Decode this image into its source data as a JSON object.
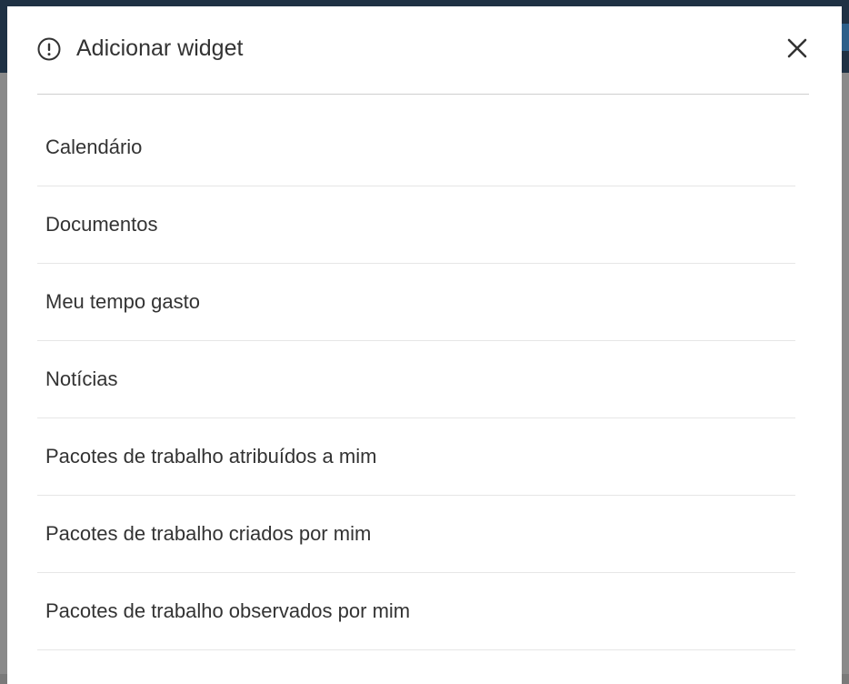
{
  "modal": {
    "title": "Adicionar widget",
    "header_icon": "info-circle-icon",
    "close_icon": "close-icon"
  },
  "widgets": [
    {
      "label": "Calendário"
    },
    {
      "label": "Documentos"
    },
    {
      "label": "Meu tempo gasto"
    },
    {
      "label": "Notícias"
    },
    {
      "label": "Pacotes de trabalho atribuídos a mim"
    },
    {
      "label": "Pacotes de trabalho criados por mim"
    },
    {
      "label": "Pacotes de trabalho observados por mim"
    }
  ],
  "colors": {
    "topbar": "#1f3144",
    "backdrop": "#8a8a8a",
    "text": "#333333"
  }
}
